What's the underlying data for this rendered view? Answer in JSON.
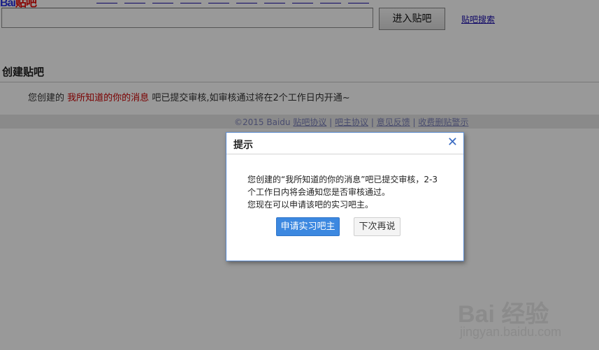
{
  "header": {
    "logo_text_a": "Bai",
    "logo_text_b": "贴吧"
  },
  "search": {
    "input_value": "",
    "button_label": "进入贴吧",
    "search_link": "贴吧搜索"
  },
  "section": {
    "title": "创建贴吧",
    "notice_prefix": "您创建的",
    "notice_bar_name": "我所知道的你的消息",
    "notice_suffix": "吧已提交审核,如审核通过将在2个工作日内开通~"
  },
  "footer": {
    "copyright": "©2015 Baidu",
    "links": [
      "贴吧协议",
      "吧主协议",
      "意见反馈",
      "收费删贴警示"
    ]
  },
  "dialog": {
    "title": "提示",
    "message_line1": "您创建的“我所知道的你的消息”吧已提交审核，2-3",
    "message_line2": "个工作日内将会通知您是否审核通过。",
    "message_line3": "您现在可以申请该吧的实习吧主。",
    "primary_button": "申请实习吧主",
    "secondary_button": "下次再说",
    "close_icon": "close-icon"
  },
  "watermark": {
    "brand": "Bai 经验",
    "site": "jingyan.baidu.com"
  }
}
